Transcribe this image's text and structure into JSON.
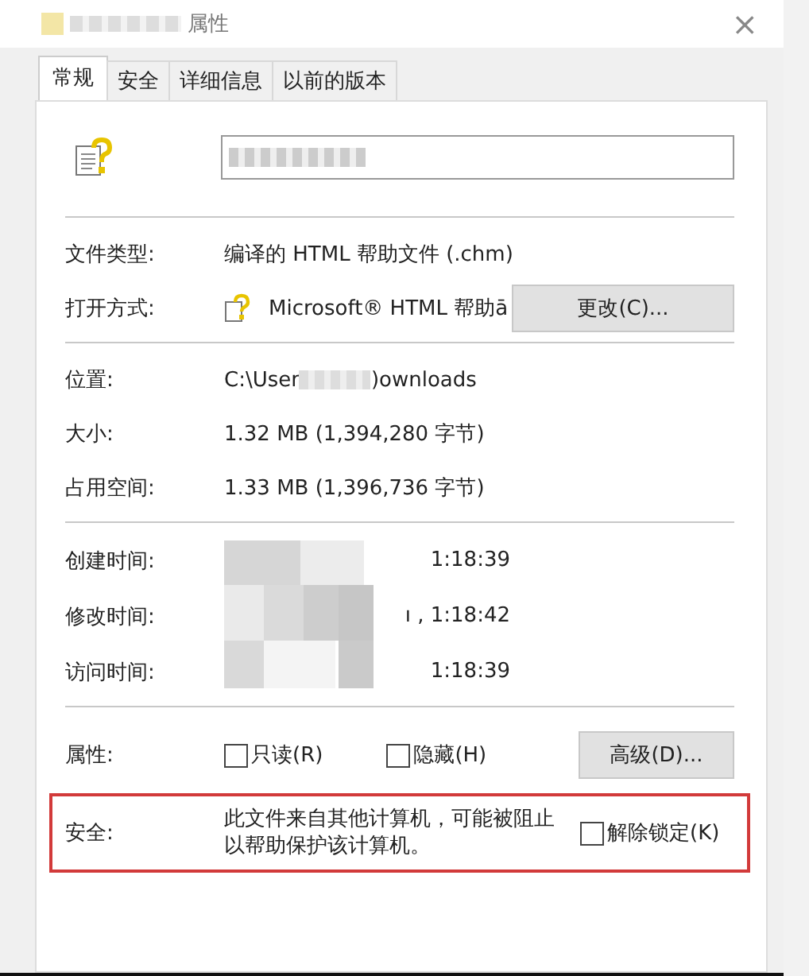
{
  "window": {
    "title": "属性",
    "close": "×"
  },
  "tabs": [
    {
      "label": "常规",
      "selected": true
    },
    {
      "label": "安全",
      "selected": false
    },
    {
      "label": "详细信息",
      "selected": false
    },
    {
      "label": "以前的版本",
      "selected": false
    }
  ],
  "file_type": {
    "label": "文件类型:",
    "value": "编译的 HTML 帮助文件 (.chm)"
  },
  "open_with": {
    "label": "打开方式:",
    "value": "Microsoft® HTML 帮助ā",
    "button": "更改(C)..."
  },
  "location": {
    "label": "位置:",
    "value_start": "C:\\User",
    "value_end": ")ownloads"
  },
  "size": {
    "label": "大小:",
    "value": "1.32 MB (1,394,280 字节)"
  },
  "size_on_disk": {
    "label": "占用空间:",
    "value": "1.33 MB (1,396,736 字节)"
  },
  "times": [
    {
      "label": "创建时间:",
      "value": "1:18:39"
    },
    {
      "label": "修改时间:",
      "value": "ı , 1:18:42"
    },
    {
      "label": "访问时间:",
      "value": "1:18:39"
    }
  ],
  "attributes": {
    "label": "属性:",
    "options": [
      {
        "label": "只读(R)",
        "checked": false
      },
      {
        "label": "隐藏(H)",
        "checked": false
      }
    ],
    "button": "高级(D)..."
  },
  "security": {
    "label": "安全:",
    "message": "此文件来自其他计算机，可能被阻止以帮助保护该计算机。",
    "unblock": {
      "label": "解除锁定(K)",
      "checked": false
    }
  }
}
